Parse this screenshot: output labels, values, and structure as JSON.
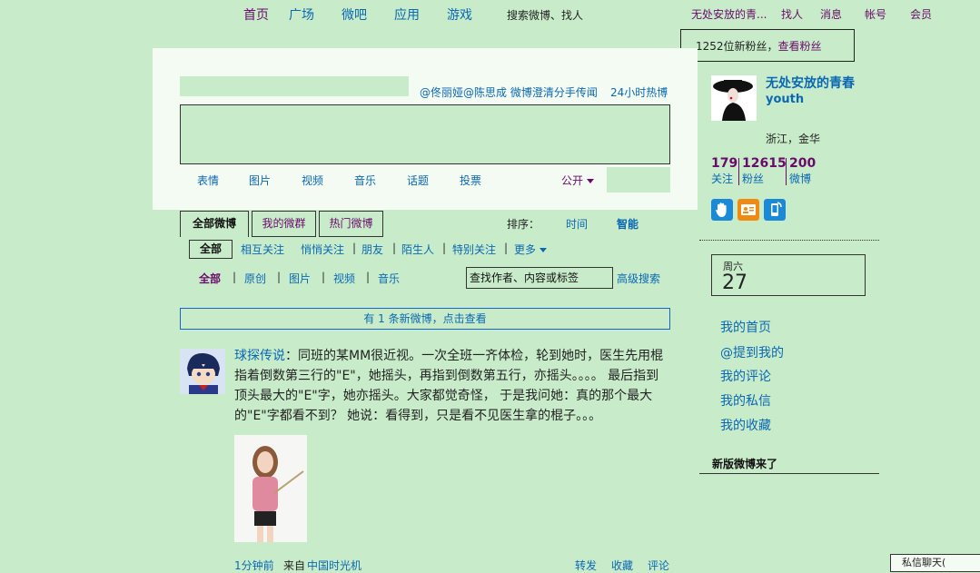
{
  "nav": {
    "items": [
      "首页",
      "广场",
      "微吧",
      "应用",
      "游戏"
    ],
    "search": "搜索微博、找人",
    "right": [
      "无处安放的青...",
      "找人",
      "消息",
      "帐号",
      "会员"
    ]
  },
  "fans_notice": {
    "text": "1252位新粉丝，",
    "link": "查看粉丝"
  },
  "publisher": {
    "hot_topic": "@佟丽娅@陈思成 微博澄清分手传闻",
    "hot_link": "24小时热博",
    "tools": [
      "表情",
      "图片",
      "视频",
      "音乐",
      "话题",
      "投票"
    ],
    "visibility": "公开"
  },
  "tabs": [
    "全部微博",
    "我的微群",
    "热门微博"
  ],
  "sort": {
    "label": "排序：",
    "time": "时间",
    "smart": "智能"
  },
  "filters": [
    "全部",
    "相互关注",
    "悄悄关注",
    "朋友",
    "陌生人",
    "特别关注",
    "更多"
  ],
  "subfilters": [
    "全部",
    "原创",
    "图片",
    "视频",
    "音乐"
  ],
  "search_box": {
    "value": "查找作者、内容或标签",
    "advanced": "高级搜索"
  },
  "new_notice": "有 1 条新微博，点击查看",
  "feed": {
    "author": "球探传说",
    "text": "：同班的某MM很近视。一次全班一齐体检，轮到她时，医生先用棍指着倒数第三行的\"E\"，她摇头，再指到倒数第五行，亦摇头。。。。 最后指到顶头最大的\"E\"字，她亦摇头。大家都觉奇怪， 于是我问她：真的那个最大的\"E\"字都看不到？ 她说：看得到，只是看不见医生拿的棍子。。。",
    "time": "1分钟前",
    "from": "来自",
    "source": "中国时光机",
    "actions": [
      "转发",
      "收藏",
      "评论"
    ]
  },
  "profile": {
    "name": "无处安放的青春",
    "id": "youth",
    "location": "浙江，金华",
    "stats": [
      {
        "num": "179",
        "label": "关注"
      },
      {
        "num": "12615",
        "label": "粉丝"
      },
      {
        "num": "200",
        "label": "微博"
      }
    ]
  },
  "calendar": {
    "weekday": "周六",
    "day": "27"
  },
  "sidebar_links": [
    "我的首页",
    "@提到我的",
    "我的评论",
    "我的私信",
    "我的收藏"
  ],
  "new_version": "新版微博来了",
  "chat": "私信聊天(",
  "colors": {
    "background": "#c8ecca",
    "link": "#0b67b3",
    "accent": "#6a0a6a"
  }
}
